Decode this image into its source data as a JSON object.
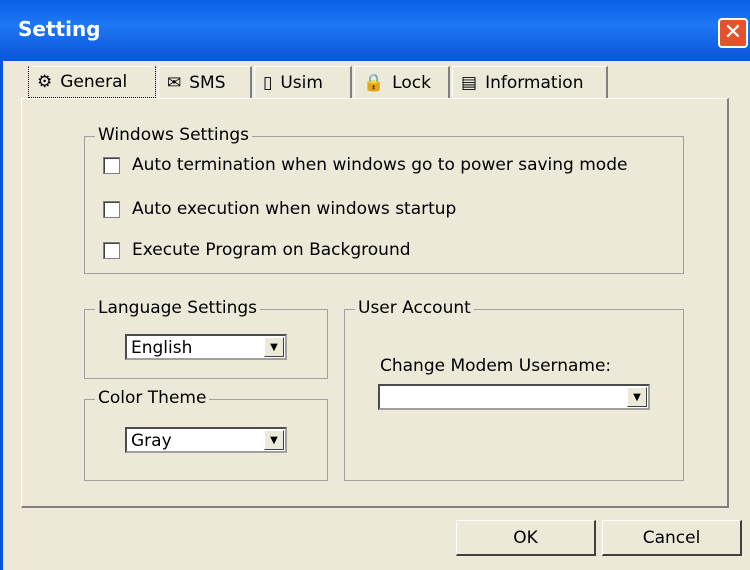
{
  "window": {
    "title": "Setting"
  },
  "tabs": [
    {
      "label": "General",
      "icon": "gear-icon"
    },
    {
      "label": "SMS",
      "icon": "envelope-icon"
    },
    {
      "label": "Usim",
      "icon": "sim-card-icon"
    },
    {
      "label": "Lock",
      "icon": "lock-icon"
    },
    {
      "label": "Information",
      "icon": "document-icon"
    }
  ],
  "windows_settings": {
    "legend": "Windows Settings",
    "options": [
      {
        "label": "Auto termination when windows go to power saving mode",
        "checked": false
      },
      {
        "label": "Auto execution when windows startup",
        "checked": false
      },
      {
        "label": "Execute Program on Background",
        "checked": false
      }
    ]
  },
  "language_settings": {
    "legend": "Language Settings",
    "value": "English"
  },
  "color_theme": {
    "legend": "Color Theme",
    "value": "Gray"
  },
  "user_account": {
    "legend": "User Account",
    "label": "Change Modem Username:",
    "value": ""
  },
  "buttons": {
    "ok": "OK",
    "cancel": "Cancel"
  }
}
